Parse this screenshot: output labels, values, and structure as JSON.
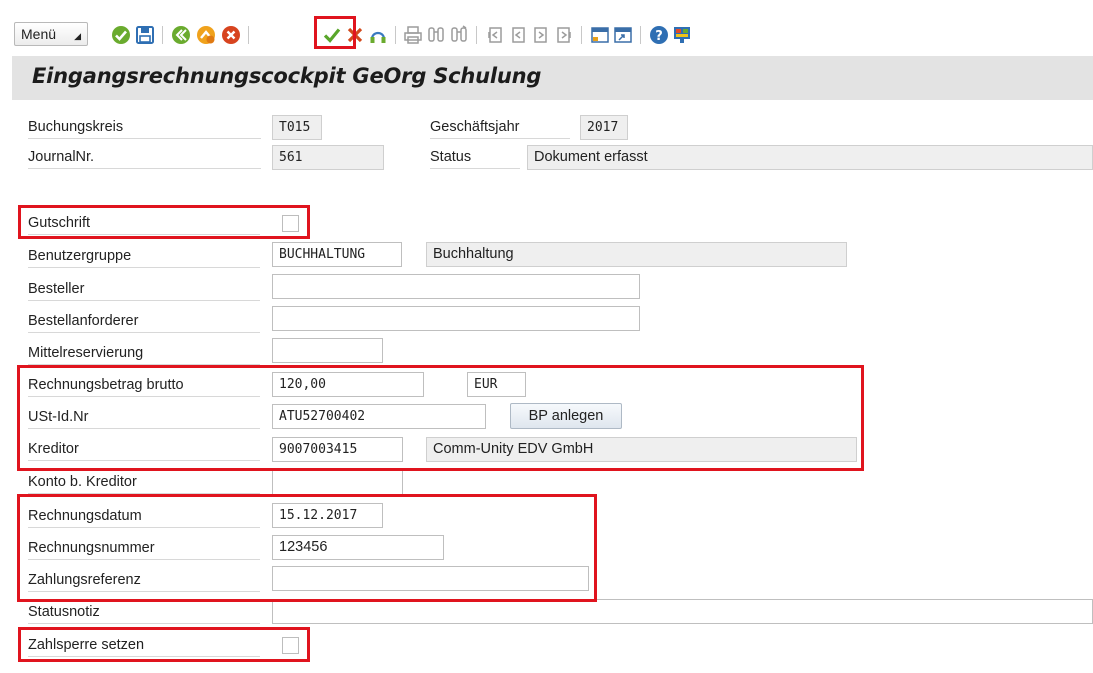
{
  "toolbar": {
    "menu_label": "Menü",
    "icons": [
      "enter-icon",
      "save-icon",
      "back-icon",
      "exit-icon",
      "cancel-icon",
      "check-icon",
      "delete-icon",
      "user-icon",
      "print-icon",
      "find-icon",
      "find-next-icon",
      "first-page-icon",
      "previous-page-icon",
      "next-page-icon",
      "last-page-icon",
      "new-session-icon",
      "shortcut-icon",
      "help-icon",
      "customize-layout-icon"
    ]
  },
  "title": "Eingangsrechnungscockpit GeOrg Schulung",
  "header": {
    "buchungskreis_label": "Buchungskreis",
    "buchungskreis_value": "T015",
    "geschaeftsjahr_label": "Geschäftsjahr",
    "geschaeftsjahr_value": "2017",
    "journalnr_label": "JournalNr.",
    "journalnr_value": "561",
    "status_label": "Status",
    "status_value": "Dokument erfasst"
  },
  "form": {
    "gutschrift_label": "Gutschrift",
    "benutzergruppe_label": "Benutzergruppe",
    "benutzergruppe_value": "BUCHHALTUNG",
    "benutzergruppe_text": "Buchhaltung",
    "besteller_label": "Besteller",
    "besteller_value": "",
    "bestellanforderer_label": "Bestellanforderer",
    "bestellanforderer_value": "",
    "mittelreservierung_label": "Mittelreservierung",
    "mittelreservierung_value": "",
    "rechnungsbetrag_label": "Rechnungsbetrag brutto",
    "rechnungsbetrag_value": "120,00",
    "waehrung_value": "EUR",
    "ustid_label": "USt-Id.Nr",
    "ustid_value": "ATU52700402",
    "bp_anlegen_label": "BP anlegen",
    "kreditor_label": "Kreditor",
    "kreditor_value": "9007003415",
    "kreditor_name": "Comm-Unity EDV GmbH",
    "konto_label": "Konto b. Kreditor",
    "konto_value": "",
    "rechnungsdatum_label": "Rechnungsdatum",
    "rechnungsdatum_value": "15.12.2017",
    "rechnungsnummer_label": "Rechnungsnummer",
    "rechnungsnummer_value": "123456",
    "zahlungsreferenz_label": "Zahlungsreferenz",
    "zahlungsreferenz_value": "",
    "statusnotiz_label": "Statusnotiz",
    "statusnotiz_value": "",
    "zahlsperre_label": "Zahlsperre setzen"
  },
  "colors": {
    "highlight": "#e0141e",
    "titlebar_bg": "#e3e3e3",
    "readonly_bg": "#efefef"
  }
}
